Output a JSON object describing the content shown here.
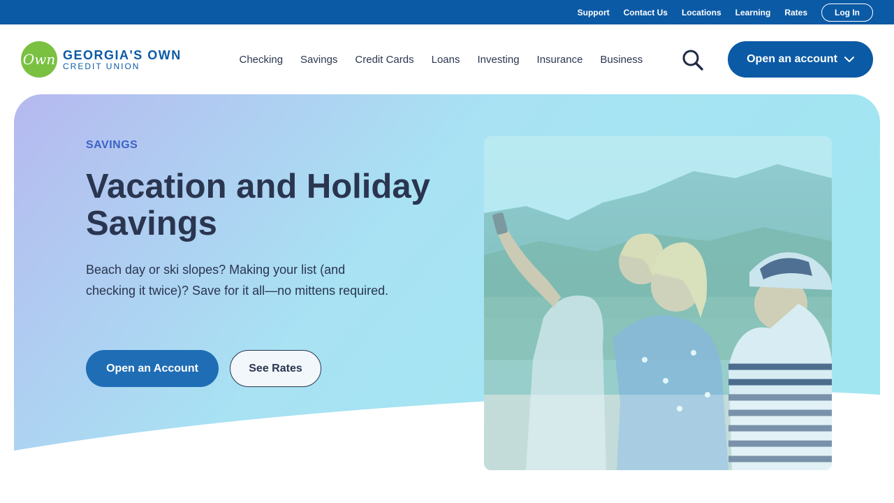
{
  "utility_bar": {
    "links": [
      "Support",
      "Contact Us",
      "Locations",
      "Learning",
      "Rates"
    ],
    "login_label": "Log In"
  },
  "header": {
    "logo": {
      "badge_text": "Own",
      "name": "GEORGIA'S OWN",
      "subtitle": "CREDIT UNION"
    },
    "nav": [
      "Checking",
      "Savings",
      "Credit Cards",
      "Loans",
      "Investing",
      "Insurance",
      "Business"
    ],
    "open_account_label": "Open an account"
  },
  "hero": {
    "eyebrow": "SAVINGS",
    "title": "Vacation and Holiday Savings",
    "body": "Beach day or ski slopes? Making your list (and checking it twice)? Save for it all—no mittens required.",
    "primary_cta": "Open an Account",
    "secondary_cta": "See Rates"
  },
  "colors": {
    "brand_blue": "#0b5aa5",
    "button_blue": "#1f6db5",
    "logo_green": "#7ac142",
    "text_dark": "#2a3550",
    "eyebrow_blue": "#3b63c6",
    "gradient_start": "#b4baf0",
    "gradient_end": "#a6e6f3"
  },
  "icons": {
    "search": "search-icon",
    "dropdown": "chevron-down-icon"
  }
}
